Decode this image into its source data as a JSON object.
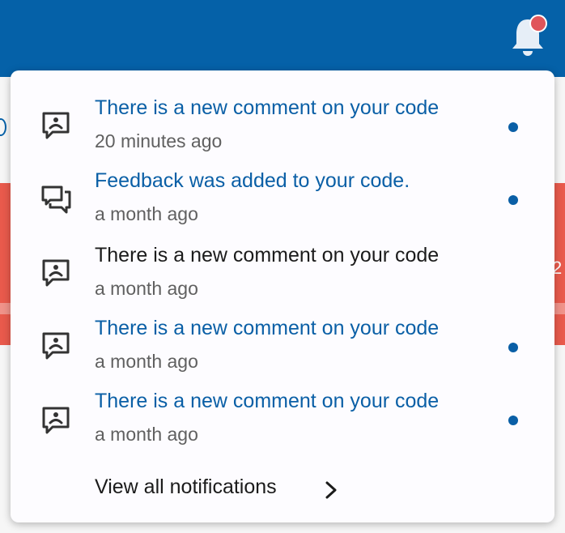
{
  "header": {
    "bell_icon": "notification-bell-icon",
    "has_unread_badge": true,
    "brand_color": "#0561a8",
    "badge_color": "#e0555a"
  },
  "notifications": {
    "items": [
      {
        "title": "There is a new comment on your code",
        "time": "20 minutes ago",
        "icon": "comment-icon",
        "unread": true
      },
      {
        "title": "Feedback was added to your code.",
        "time": "a month ago",
        "icon": "feedback-icon",
        "unread": true
      },
      {
        "title": "There is a new comment on your code",
        "time": "a month ago",
        "icon": "comment-icon",
        "unread": false
      },
      {
        "title": "There is a new comment on your code",
        "time": "a month ago",
        "icon": "comment-icon",
        "unread": true
      },
      {
        "title": "There is a new comment on your code",
        "time": "a month ago",
        "icon": "comment-icon",
        "unread": true
      }
    ],
    "view_all_label": "View all notifications",
    "view_all_icon": "chevron-right-icon",
    "unread_color": "#0a5fa6"
  },
  "background": {
    "edge_text": "2"
  }
}
